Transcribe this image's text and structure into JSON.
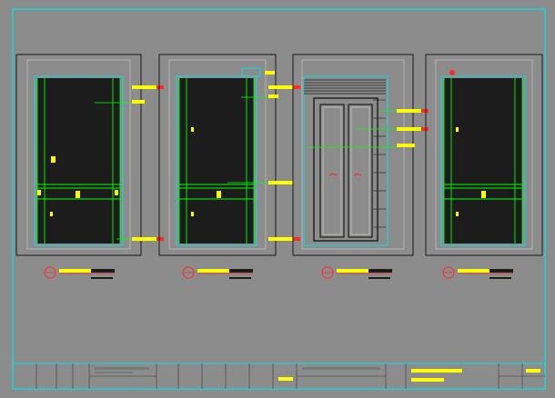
{
  "drawing": {
    "panels": [
      {
        "id": "elev-1",
        "type": "wall-panel"
      },
      {
        "id": "elev-2",
        "type": "wall-panel"
      },
      {
        "id": "elev-3",
        "type": "door"
      },
      {
        "id": "elev-4",
        "type": "wall-panel"
      }
    ],
    "colors": {
      "background": "#8c8c8c",
      "frame": "#00e5e5",
      "dimension": "#00ff00",
      "annotation": "#ffff00",
      "section_mark": "#ff2b2b",
      "panel_fill": "#1c1c1c"
    }
  }
}
